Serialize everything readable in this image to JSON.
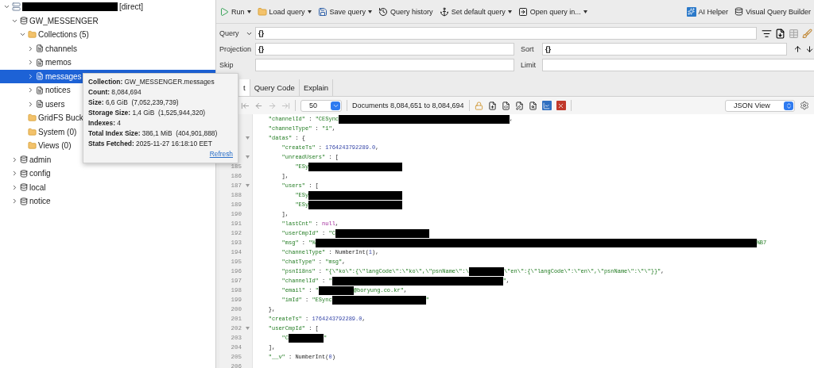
{
  "tree": [
    {
      "kind": "server",
      "masked": true,
      "label": "[direct]",
      "expanded": true,
      "selected": false,
      "children": [
        {
          "kind": "database",
          "label": "GW_MESSENGER",
          "expanded": true,
          "selected": false,
          "children": [
            {
              "kind": "folder",
              "label": "Collections (5)",
              "expanded": true,
              "selected": false,
              "children": [
                {
                  "kind": "collection",
                  "label": "channels",
                  "expanded": false,
                  "selected": false
                },
                {
                  "kind": "collection",
                  "label": "memos",
                  "expanded": false,
                  "selected": false
                },
                {
                  "kind": "collection",
                  "label": "messages",
                  "expanded": false,
                  "selected": true
                },
                {
                  "kind": "collection",
                  "label": "notices",
                  "expanded": false,
                  "selected": false
                },
                {
                  "kind": "collection",
                  "label": "users",
                  "expanded": false,
                  "selected": false
                }
              ]
            },
            {
              "kind": "folder",
              "label": "GridFS Buck",
              "selected": false
            },
            {
              "kind": "folder",
              "label": "System (0)",
              "selected": false
            },
            {
              "kind": "folder",
              "label": "Views (0)",
              "selected": false
            }
          ]
        },
        {
          "kind": "database",
          "label": "admin",
          "expanded": false,
          "selected": false
        },
        {
          "kind": "database",
          "label": "config",
          "expanded": false,
          "selected": false
        },
        {
          "kind": "database",
          "label": "local",
          "expanded": false,
          "selected": false
        },
        {
          "kind": "database",
          "label": "notice",
          "expanded": false,
          "selected": false
        }
      ]
    }
  ],
  "tooltip": {
    "lines": [
      "**Collection:** GW_MESSENGER.messages",
      "**Count:** 8,084,694",
      "**Size:** 6,6 GiB  (7,052,239,739)",
      "**Storage Size:** 1,4 GiB  (1,525,944,320)",
      "**Indexes:** 4",
      "**Total Index Size:** 386,1 MiB  (404,901,888)",
      "**Stats Fetched:** 2025-11-27 16:18:10 EET"
    ],
    "link": "Refresh"
  },
  "toolbar": {
    "left": [
      {
        "label": "Run",
        "menu": true
      },
      {
        "label": "Load query",
        "menu": true
      },
      {
        "label": "Save query",
        "menu": true
      },
      {
        "label": "Query history"
      },
      {
        "label": "Set default query",
        "menu": true
      },
      {
        "label": "Open query in...",
        "menu": true
      }
    ],
    "right": [
      {
        "label": "AI Helper"
      },
      {
        "label": "Visual Query Builder"
      }
    ]
  },
  "query_form": [
    {
      "label": "Query",
      "value": "{}"
    },
    {
      "label": "Projection",
      "value": "{}"
    },
    {
      "label": "Sort",
      "value": "{}"
    },
    {
      "label": "Skip"
    },
    {
      "label": "Limit"
    }
  ],
  "tabs": [
    {
      "label": "t",
      "selected": true
    },
    {
      "label": "Query Code",
      "selected": false
    },
    {
      "label": "Explain",
      "selected": false
    }
  ],
  "results_bar": {
    "page_size": "50",
    "range": "Documents 8,084,651 to 8,084,694",
    "view": "JSON View"
  },
  "code_lines": [
    {
      "parts": [
        {
          "kind": "str",
          "text": "    \"channelId\""
        },
        {
          "kind": "plain",
          "text": " : "
        },
        {
          "kind": "str",
          "text": "\"CESync"
        },
        {
          "kind": "redacted"
        },
        {
          "kind": "plain",
          "text": ","
        }
      ]
    },
    {
      "parts": [
        {
          "kind": "str",
          "text": "    \"channelType\""
        },
        {
          "kind": "plain",
          "text": " : "
        },
        {
          "kind": "str",
          "text": "\"1\""
        },
        {
          "kind": "plain",
          "text": ","
        }
      ]
    },
    {
      "fold": true,
      "parts": [
        {
          "kind": "str",
          "text": "    \"datas\""
        },
        {
          "kind": "plain",
          "text": " : {"
        }
      ]
    },
    {
      "parts": [
        {
          "kind": "str",
          "text": "        \"createTs\""
        },
        {
          "kind": "plain",
          "text": " : "
        },
        {
          "kind": "num",
          "text": "1764243792289.0"
        },
        {
          "kind": "plain",
          "text": ","
        }
      ]
    },
    {
      "fold": true,
      "parts": [
        {
          "kind": "str",
          "text": "        \"unreadUsers\""
        },
        {
          "kind": "plain",
          "text": " : ["
        }
      ]
    },
    {
      "number": "185",
      "parts": [
        {
          "kind": "str",
          "text": "            \"ESy"
        },
        {
          "kind": "redacted"
        }
      ]
    },
    {
      "number": "186",
      "parts": [
        {
          "kind": "plain",
          "text": "        ],"
        }
      ]
    },
    {
      "number": "187",
      "fold": true,
      "parts": [
        {
          "kind": "str",
          "text": "        \"users\""
        },
        {
          "kind": "plain",
          "text": " : ["
        }
      ]
    },
    {
      "number": "188",
      "parts": [
        {
          "kind": "str",
          "text": "            \"ESy"
        },
        {
          "kind": "redacted"
        }
      ]
    },
    {
      "number": "189",
      "parts": [
        {
          "kind": "str",
          "text": "            \"ESy"
        },
        {
          "kind": "redacted"
        }
      ]
    },
    {
      "number": "190",
      "parts": [
        {
          "kind": "plain",
          "text": "        ],"
        }
      ]
    },
    {
      "number": "191",
      "parts": [
        {
          "kind": "str",
          "text": "        \"lastCnt\""
        },
        {
          "kind": "plain",
          "text": " : "
        },
        {
          "kind": "null",
          "text": "null"
        },
        {
          "kind": "plain",
          "text": ","
        }
      ]
    },
    {
      "number": "192",
      "parts": [
        {
          "kind": "str",
          "text": "        \"userCmpId\""
        },
        {
          "kind": "plain",
          "text": " : "
        },
        {
          "kind": "str",
          "text": "\"C"
        },
        {
          "kind": "redacted"
        }
      ]
    },
    {
      "number": "193",
      "parts": [
        {
          "kind": "str",
          "text": "        \"msg\""
        },
        {
          "kind": "plain",
          "text": " : "
        },
        {
          "kind": "str",
          "text": "\"%"
        },
        {
          "kind": "redacted"
        },
        {
          "kind": "str",
          "text": "%B7"
        }
      ]
    },
    {
      "number": "194",
      "parts": [
        {
          "kind": "str",
          "text": "        \"channelType\""
        },
        {
          "kind": "plain",
          "text": " : NumberInt("
        },
        {
          "kind": "num",
          "text": "1"
        },
        {
          "kind": "plain",
          "text": "),"
        }
      ]
    },
    {
      "number": "195",
      "parts": [
        {
          "kind": "str",
          "text": "        \"chatType\""
        },
        {
          "kind": "plain",
          "text": " : "
        },
        {
          "kind": "str",
          "text": "\"msg\""
        },
        {
          "kind": "plain",
          "text": ","
        }
      ]
    },
    {
      "number": "196",
      "parts": [
        {
          "kind": "str",
          "text": "        \"psnI18ns\""
        },
        {
          "kind": "plain",
          "text": " : "
        },
        {
          "kind": "str",
          "text": "\"{\\\"ko\\\":{\\\"langCode\\\":\\\"ko\\\",\\\"psnName\\\":\\"
        },
        {
          "kind": "redacted"
        },
        {
          "kind": "str",
          "text": "\\\"en\\\":{\\\"langCode\\\":\\\"en\\\",\\\"psnName\\\":\\\"\\\"}}\""
        },
        {
          "kind": "plain",
          "text": ","
        }
      ]
    },
    {
      "number": "197",
      "parts": [
        {
          "kind": "str",
          "text": "        \"channelId\""
        },
        {
          "kind": "plain",
          "text": " : "
        },
        {
          "kind": "str",
          "text": "\""
        },
        {
          "kind": "redacted"
        },
        {
          "kind": "str",
          "text": "\""
        },
        {
          "kind": "plain",
          "text": ","
        }
      ]
    },
    {
      "number": "198",
      "parts": [
        {
          "kind": "str",
          "text": "        \"email\""
        },
        {
          "kind": "plain",
          "text": " : "
        },
        {
          "kind": "str",
          "text": "\""
        },
        {
          "kind": "redacted"
        },
        {
          "kind": "str",
          "text": "@boryung.co.kr\""
        },
        {
          "kind": "plain",
          "text": ","
        }
      ]
    },
    {
      "number": "199",
      "parts": [
        {
          "kind": "str",
          "text": "        \"imId\""
        },
        {
          "kind": "plain",
          "text": " : "
        },
        {
          "kind": "str",
          "text": "\"ESync"
        },
        {
          "kind": "redacted"
        },
        {
          "kind": "str",
          "text": "\""
        }
      ]
    },
    {
      "number": "200",
      "parts": [
        {
          "kind": "plain",
          "text": "    },"
        }
      ]
    },
    {
      "number": "201",
      "parts": [
        {
          "kind": "str",
          "text": "    \"createTs\""
        },
        {
          "kind": "plain",
          "text": " : "
        },
        {
          "kind": "num",
          "text": "1764243792289.0"
        },
        {
          "kind": "plain",
          "text": ","
        }
      ]
    },
    {
      "number": "202",
      "fold": true,
      "parts": [
        {
          "kind": "str",
          "text": "    \"userCmpId\""
        },
        {
          "kind": "plain",
          "text": " : ["
        }
      ]
    },
    {
      "number": "203",
      "parts": [
        {
          "kind": "str",
          "text": "        \"C"
        },
        {
          "kind": "redacted"
        },
        {
          "kind": "str",
          "text": "\""
        }
      ]
    },
    {
      "number": "204",
      "parts": [
        {
          "kind": "plain",
          "text": "    ],"
        }
      ]
    },
    {
      "number": "205",
      "parts": [
        {
          "kind": "str",
          "text": "    \"__v\""
        },
        {
          "kind": "plain",
          "text": " : NumberInt("
        },
        {
          "kind": "num",
          "text": "0"
        },
        {
          "kind": "plain",
          "text": ")"
        }
      ]
    },
    {
      "number": "206"
    }
  ]
}
